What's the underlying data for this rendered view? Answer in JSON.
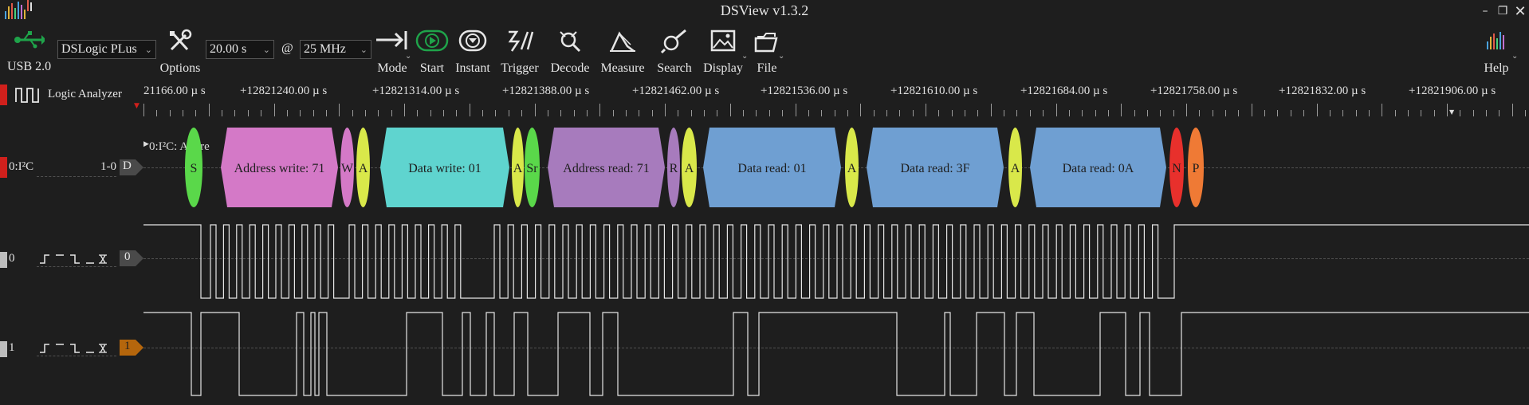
{
  "window": {
    "title": "DSView v1.3.2",
    "controls": [
      "minimize-icon",
      "restore-icon",
      "close-icon"
    ]
  },
  "toolbar": {
    "usb_label": "USB 2.0",
    "device_select": "DSLogic PLus",
    "options_label": "Options",
    "duration_select": "20.00 s",
    "at_symbol": "@",
    "rate_select": "25 MHz",
    "mode_label": "Mode",
    "start_label": "Start",
    "instant_label": "Instant",
    "trigger_label": "Trigger",
    "decode_label": "Decode",
    "measure_label": "Measure",
    "search_label": "Search",
    "display_label": "Display",
    "file_label": "File",
    "help_label": "Help"
  },
  "colors": {
    "background": "#1e1e1e",
    "accent_green": "#1fa34a",
    "marker_red": "#d0201c",
    "channel1_badge": "#b5660c",
    "seg_start": "#5ad84a",
    "seg_address_write": "#d479c7",
    "seg_ack": "#d9e84a",
    "seg_data_write": "#5fd4cf",
    "seg_address_read": "#a77bbd",
    "seg_data_read": "#6f9fd2",
    "seg_nack": "#e8302c",
    "seg_stop": "#ef7a35"
  },
  "left_panel": {
    "mode_title": "Logic Analyzer",
    "decoder_channel": {
      "name": "0:I²C",
      "range": "1-0",
      "badge": "D"
    },
    "channel0": {
      "name": "0",
      "badge": "0"
    },
    "channel1": {
      "name": "1",
      "badge": "1"
    }
  },
  "ruler": {
    "labels": [
      "21166.00 µ s",
      "+12821240.00 µ s",
      "+12821314.00 µ s",
      "+12821388.00 µ s",
      "+12821462.00 µ s",
      "+12821536.00 µ s",
      "+12821610.00 µ s",
      "+12821684.00 µ s",
      "+12821758.00 µ s",
      "+12821832.00 µ s",
      "+12821906.00 µ s"
    ]
  },
  "decoder": {
    "row_label": "0:I²C: Addre",
    "segments": [
      {
        "label": "S",
        "kind": "start"
      },
      {
        "label": "Address write: 71",
        "kind": "address_write"
      },
      {
        "label": "W",
        "kind": "rw_write"
      },
      {
        "label": "A",
        "kind": "ack"
      },
      {
        "label": "Data write: 01",
        "kind": "data_write"
      },
      {
        "label": "A",
        "kind": "ack"
      },
      {
        "label": "Sr",
        "kind": "start"
      },
      {
        "label": "Address read: 71",
        "kind": "address_read"
      },
      {
        "label": "R",
        "kind": "rw_read"
      },
      {
        "label": "A",
        "kind": "ack"
      },
      {
        "label": "Data read: 01",
        "kind": "data_read"
      },
      {
        "label": "A",
        "kind": "ack"
      },
      {
        "label": "Data read: 3F",
        "kind": "data_read"
      },
      {
        "label": "A",
        "kind": "ack"
      },
      {
        "label": "Data read: 0A",
        "kind": "data_read"
      },
      {
        "label": "N",
        "kind": "nack"
      },
      {
        "label": "P",
        "kind": "stop"
      }
    ]
  }
}
